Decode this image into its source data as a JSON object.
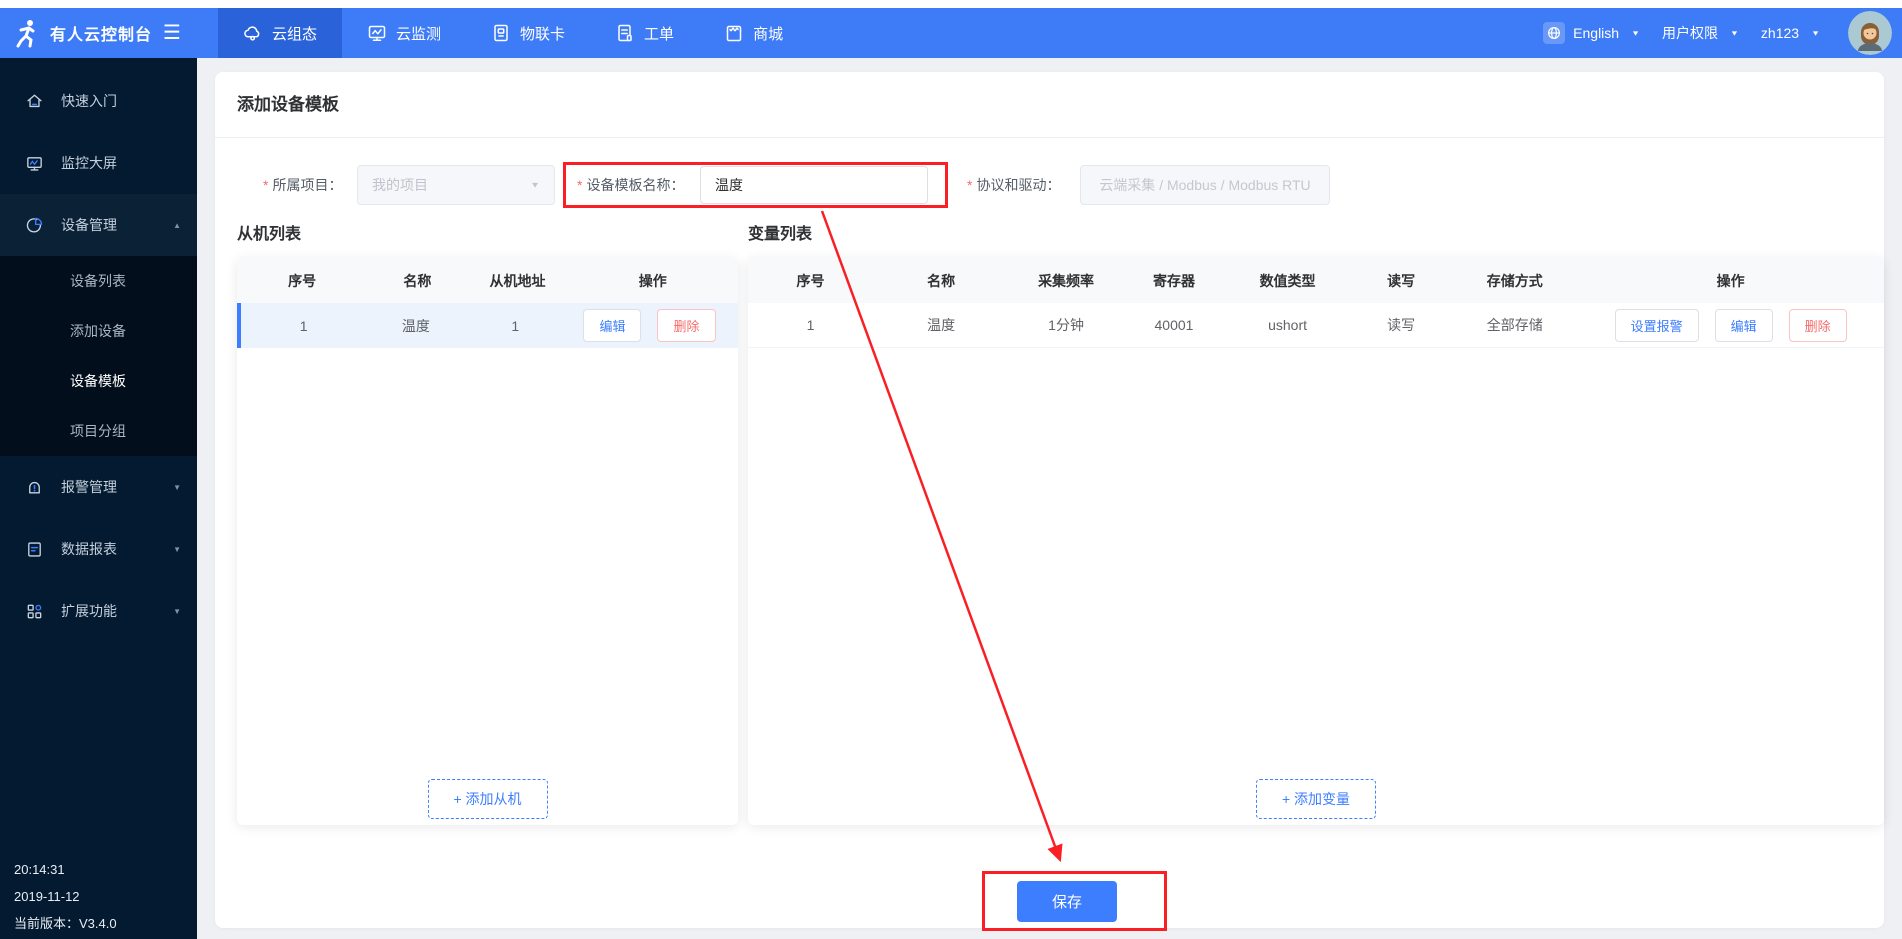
{
  "icons": {
    "hamburger": "☰",
    "caret_down": "▼",
    "caret_up": "▲"
  },
  "topbar": {
    "logo_text": "有人云控制台",
    "tabs": [
      {
        "label": "云组态"
      },
      {
        "label": "云监测"
      },
      {
        "label": "物联卡"
      },
      {
        "label": "工单"
      },
      {
        "label": "商城"
      }
    ],
    "language": "English",
    "permission": "用户权限",
    "username": "zh123"
  },
  "sidebar": {
    "items": [
      {
        "label": "快速入门"
      },
      {
        "label": "监控大屏"
      },
      {
        "label": "设备管理"
      },
      {
        "label": "报警管理"
      },
      {
        "label": "数据报表"
      },
      {
        "label": "扩展功能"
      }
    ],
    "submenu": [
      "设备列表",
      "添加设备",
      "设备模板",
      "项目分组"
    ],
    "footer": {
      "time": "20:14:31",
      "date": "2019-11-12",
      "version": "当前版本：V3.4.0"
    }
  },
  "page": {
    "title": "添加设备模板",
    "required_mark": "*",
    "form": {
      "project_label": "所属项目：",
      "project_value": "我的项目",
      "template_label": "设备模板名称：",
      "template_value": "温度",
      "protocol_label": "协议和驱动：",
      "protocol_value": "云端采集 / Modbus / Modbus RTU"
    },
    "slave": {
      "title": "从机列表",
      "headers": [
        "序号",
        "名称",
        "从机地址",
        "操作"
      ],
      "row": {
        "index": "1",
        "name": "温度",
        "address": "1"
      },
      "edit": "编辑",
      "del": "删除",
      "add": "+ 添加从机"
    },
    "vars": {
      "title": "变量列表",
      "headers": [
        "序号",
        "名称",
        "采集频率",
        "寄存器",
        "数值类型",
        "读写",
        "存储方式",
        "操作"
      ],
      "row": {
        "index": "1",
        "name": "温度",
        "freq": "1分钟",
        "register": "40001",
        "dtype": "ushort",
        "rw": "读写",
        "storage": "全部存储"
      },
      "alarm": "设置报警",
      "edit": "编辑",
      "del": "删除",
      "add": "+ 添加变量"
    },
    "save": "保存"
  },
  "colors": {
    "navbar": "#3e7bf7",
    "navbar_active": "#2a62d9",
    "sidebar_bg": "#041a30",
    "accent": "#3d7eff",
    "danger": "#f56c6c",
    "annotation": "#f91f25",
    "page_bg": "#eef0f4"
  }
}
